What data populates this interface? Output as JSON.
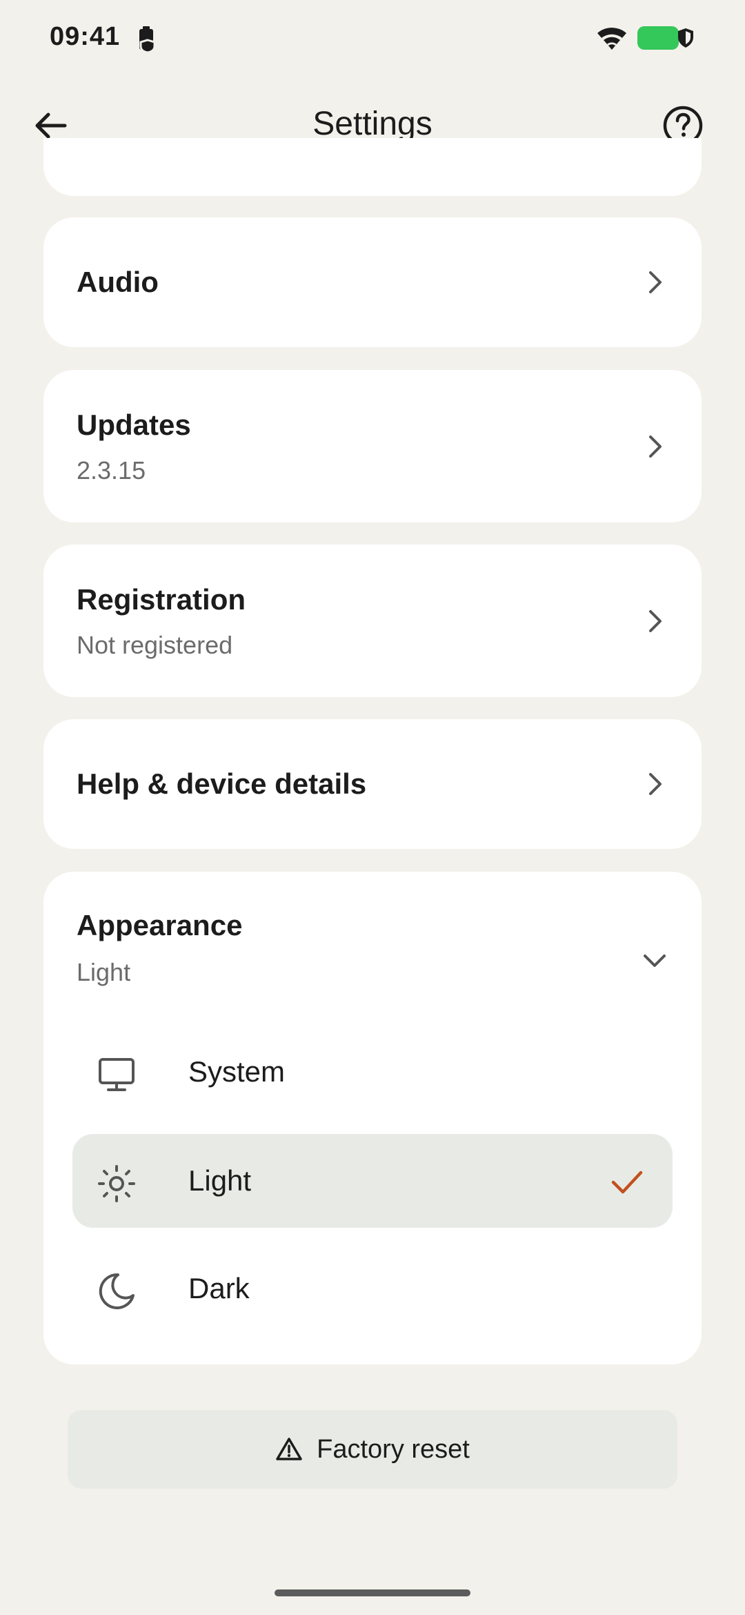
{
  "status_bar": {
    "time": "09:41",
    "icons": [
      "battery-saver-icon",
      "wifi-icon",
      "battery-icon",
      "shield-icon"
    ],
    "battery_color": "#34c759"
  },
  "app_bar": {
    "title": "Settings",
    "back_icon": "back-arrow-icon",
    "help_icon": "help-circle-icon"
  },
  "settings": {
    "audio": {
      "title": "Audio"
    },
    "updates": {
      "title": "Updates",
      "subtitle": "2.3.15"
    },
    "registration": {
      "title": "Registration",
      "subtitle": "Not registered"
    },
    "help": {
      "title": "Help & device details"
    },
    "appearance": {
      "title": "Appearance",
      "subtitle": "Light",
      "options": [
        {
          "label": "System",
          "icon": "monitor-icon",
          "selected": false
        },
        {
          "label": "Light",
          "icon": "sun-icon",
          "selected": true
        },
        {
          "label": "Dark",
          "icon": "moon-icon",
          "selected": false
        }
      ]
    }
  },
  "factory_reset": {
    "label": "Factory reset",
    "icon": "warning-icon"
  },
  "colors": {
    "background": "#f3f1eb",
    "card": "#ffffff",
    "selected_row": "#e8ebe5",
    "accent_check": "#c2501f"
  }
}
